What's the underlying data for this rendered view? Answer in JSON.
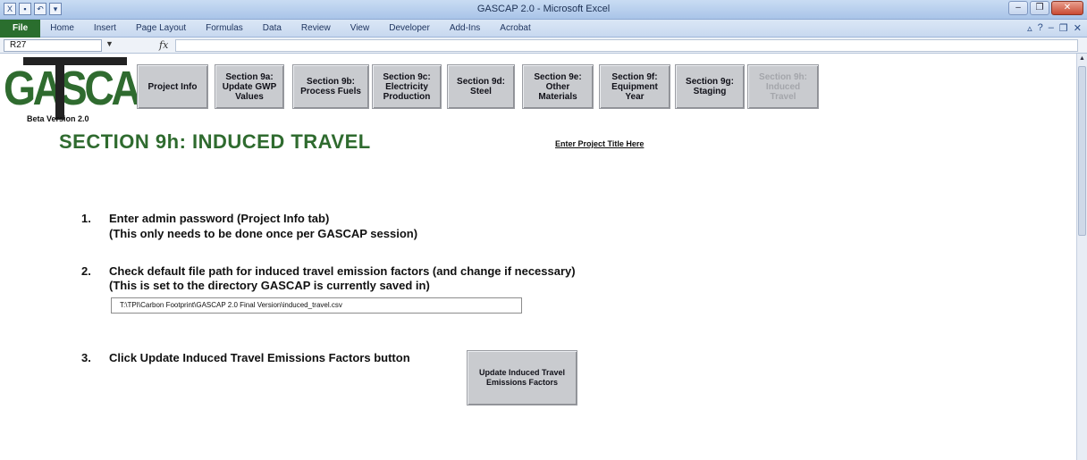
{
  "window": {
    "title": "GASCAP 2.0 - Microsoft Excel"
  },
  "ribbon": {
    "tabs": [
      "File",
      "Home",
      "Insert",
      "Page Layout",
      "Formulas",
      "Data",
      "Review",
      "View",
      "Developer",
      "Add-Ins",
      "Acrobat"
    ]
  },
  "formula_bar": {
    "name_box": "R27",
    "fx": "fx",
    "value": ""
  },
  "logo": {
    "text": "GASCAP",
    "beta": "Beta Version 2.0"
  },
  "nav": {
    "buttons": [
      {
        "label": "Project Info",
        "enabled": true
      },
      {
        "label": "Section 9a:\nUpdate GWP\nValues",
        "enabled": true
      },
      {
        "label": "Section 9b:\nProcess Fuels",
        "enabled": true
      },
      {
        "label": "Section 9c:\nElectricity\nProduction",
        "enabled": true
      },
      {
        "label": "Section 9d:\nSteel",
        "enabled": true
      },
      {
        "label": "Section 9e:\nOther\nMaterials",
        "enabled": true
      },
      {
        "label": "Section 9f:\nEquipment\nYear",
        "enabled": true
      },
      {
        "label": "Section 9g:\nStaging",
        "enabled": true
      },
      {
        "label": "Section 9h:\nInduced\nTravel",
        "enabled": false
      }
    ]
  },
  "section": {
    "title": "SECTION 9h: INDUCED TRAVEL",
    "project_title_link": "Enter Project Title Here"
  },
  "steps": [
    {
      "number": "1.",
      "lines": [
        "Enter admin password (Project Info tab)",
        "(This only needs to be done once per GASCAP session)"
      ]
    },
    {
      "number": "2.",
      "lines": [
        "Check default file path for induced travel emission factors (and change if necessary)",
        "(This is set to the directory GASCAP is currently saved in)"
      ]
    },
    {
      "number": "3.",
      "lines": [
        "Click Update Induced Travel Emissions Factors button"
      ]
    }
  ],
  "file_path": {
    "value": "T:\\TPI\\Carbon Footprint\\GASCAP 2.0 Final Version\\induced_travel.csv"
  },
  "update_button": {
    "label": "Update Induced Travel\nEmissions Factors"
  },
  "colors": {
    "brand_green": "#2f6b2f",
    "button_gray": "#c9cbcf",
    "file_tab_green": "#2a6e2e"
  }
}
